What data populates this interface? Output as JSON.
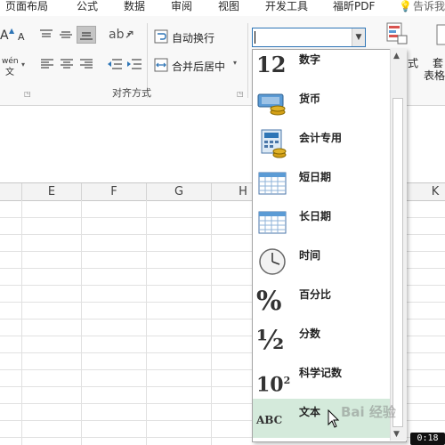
{
  "tabs": [
    "页面布局",
    "公式",
    "数据",
    "审阅",
    "视图",
    "开发工具",
    "福昕PDF",
    "告诉我"
  ],
  "ribbon": {
    "wrap_text": "自动换行",
    "merge_center": "合并后居中",
    "group_alignment": "对齐方式",
    "font_size_up": "A",
    "font_size_down": "A",
    "phonetic": "wén",
    "phonetic_sub": "文",
    "right_fragment_1": "式",
    "right_fragment_2": "套",
    "right_fragment_3": "表格"
  },
  "combo": {
    "value": ""
  },
  "columns": [
    "E",
    "F",
    "G",
    "H",
    "K"
  ],
  "formats": [
    {
      "label": "数字",
      "icon": "number-12-icon",
      "glyph": "12"
    },
    {
      "label": "货币",
      "icon": "currency-icon"
    },
    {
      "label": "会计专用",
      "icon": "accounting-icon"
    },
    {
      "label": "短日期",
      "icon": "calendar-short-icon"
    },
    {
      "label": "长日期",
      "icon": "calendar-long-icon"
    },
    {
      "label": "时间",
      "icon": "clock-icon"
    },
    {
      "label": "百分比",
      "icon": "percent-icon",
      "glyph": "%"
    },
    {
      "label": "分数",
      "icon": "fraction-icon",
      "glyph": "½"
    },
    {
      "label": "科学记数",
      "icon": "scientific-icon",
      "glyph": "10",
      "sup": "2"
    },
    {
      "label": "文本",
      "icon": "abc-icon",
      "glyph": "ABC"
    }
  ],
  "selected_format_index": 9,
  "timer": "0:18",
  "watermark": "Bai 经验",
  "colors": {
    "selected_bg": "#d4eadb",
    "accent": "#2e75b6"
  }
}
